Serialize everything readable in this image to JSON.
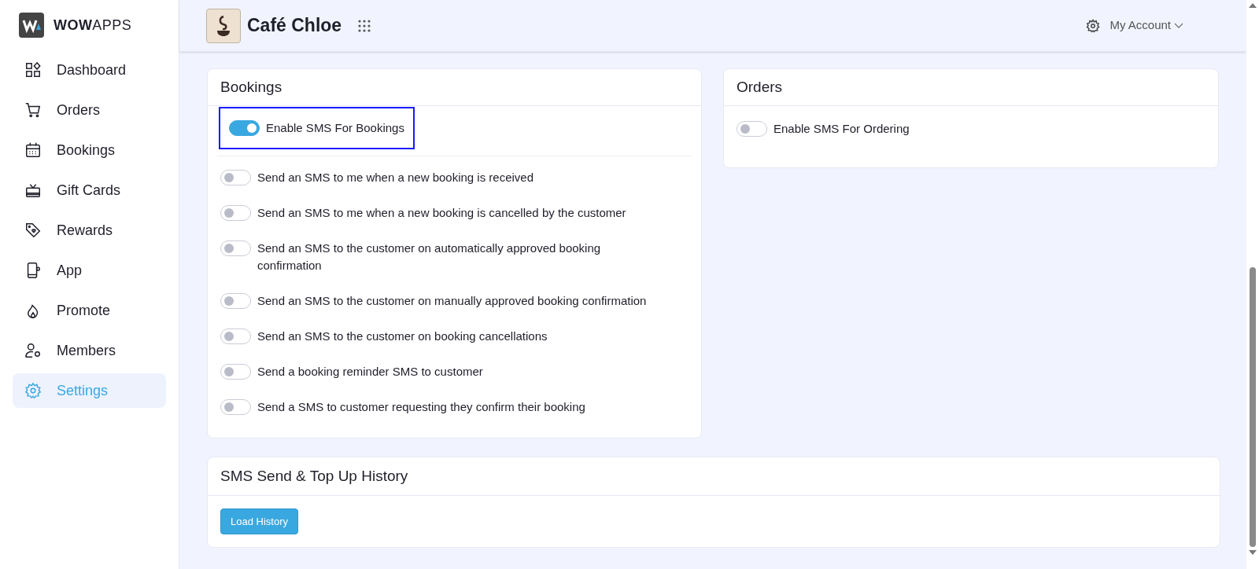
{
  "brand": {
    "bold": "WOW",
    "light": "APPS"
  },
  "sidebar": {
    "items": [
      {
        "label": "Dashboard",
        "selected": false
      },
      {
        "label": "Orders",
        "selected": false
      },
      {
        "label": "Bookings",
        "selected": false
      },
      {
        "label": "Gift Cards",
        "selected": false
      },
      {
        "label": "Rewards",
        "selected": false
      },
      {
        "label": "App",
        "selected": false
      },
      {
        "label": "Promote",
        "selected": false
      },
      {
        "label": "Members",
        "selected": false
      },
      {
        "label": "Settings",
        "selected": true
      }
    ]
  },
  "header": {
    "venue": "Café Chloe",
    "account": "My Account"
  },
  "bookings": {
    "title": "Bookings",
    "master": {
      "label": "Enable SMS For Bookings",
      "on": true,
      "focused": true
    },
    "options": [
      {
        "label": "Send an SMS to me when a new booking is received",
        "on": false
      },
      {
        "label": "Send an SMS to me when a new booking is cancelled by the customer",
        "on": false
      },
      {
        "label": "Send an SMS to the customer on automatically approved booking confirmation",
        "on": false
      },
      {
        "label": "Send an SMS to the customer on manually approved booking confirmation",
        "on": false
      },
      {
        "label": "Send an SMS to the customer on booking cancellations",
        "on": false
      },
      {
        "label": "Send a booking reminder SMS to customer",
        "on": false
      },
      {
        "label": "Send a SMS to customer requesting they confirm their booking",
        "on": false
      }
    ]
  },
  "orders": {
    "title": "Orders",
    "master": {
      "label": "Enable SMS For Ordering",
      "on": false
    }
  },
  "history": {
    "title": "SMS Send & Top Up History",
    "button": "Load History"
  }
}
